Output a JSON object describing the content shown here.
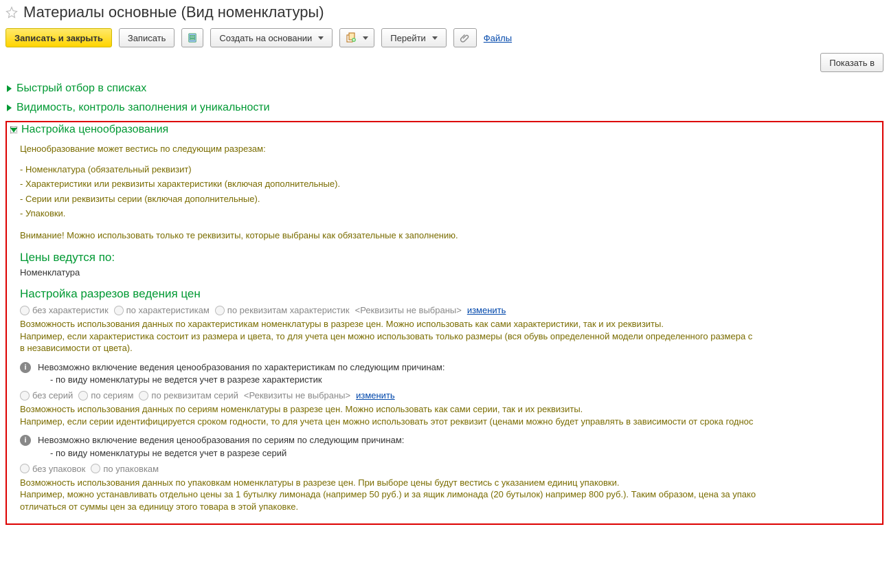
{
  "header": {
    "title": "Материалы основные (Вид номенклатуры)"
  },
  "toolbar": {
    "save_close": "Записать и закрыть",
    "save": "Записать",
    "create_based": "Создать на основании",
    "goto": "Перейти",
    "files_link": "Файлы",
    "show_all": "Показать в"
  },
  "sections": {
    "quick_filter": "Быстрый отбор в списках",
    "visibility": "Видимость, контроль заполнения и уникальности",
    "pricing": {
      "title": "Настройка ценообразования",
      "intro": "Ценообразование может вестись по следующим разрезам:",
      "items": [
        "- Номенклатура (обязательный реквизит)",
        "- Характеристики или реквизиты характеристики (включая дополнительные).",
        "- Серии или реквизиты серии (включая дополнительные).",
        "- Упаковки."
      ],
      "warning": "Внимание! Можно использовать только те реквизиты, которые выбраны как обязательные к заполнению.",
      "prices_by_heading": "Цены ведутся по:",
      "prices_by_value": "Номенклатура",
      "slices_heading": "Настройка разрезов ведения цен",
      "char_radios": {
        "r1": "без характеристик",
        "r2": "по характеристикам",
        "r3": "по реквизитам характеристик",
        "hint": "<Реквизиты не выбраны>",
        "change": "изменить"
      },
      "char_desc": "Возможность использования данных по характеристикам номенклатуры в разрезе цен. Можно использовать как сами характеристики, так и их реквизиты.\nНапример, если характеристика состоит из размера и цвета, то для учета цен можно использовать только размеры (вся обувь определенной модели определенного размера с\nв независимости от цвета).",
      "char_info_line1": "Невозможно включение ведения ценообразования по характеристикам по следующим причинам:",
      "char_info_line2": "- по виду номенклатуры не ведется учет в разрезе характеристик",
      "series_radios": {
        "r1": "без серий",
        "r2": "по сериям",
        "r3": "по реквизитам серий",
        "hint": "<Реквизиты не выбраны>",
        "change": "изменить"
      },
      "series_desc": "Возможность использования данных по сериям номенклатуры в разрезе цен. Можно использовать как сами серии, так и их реквизиты.\nНапример, если серии идентифицируется сроком годности, то для учета цен можно использовать этот реквизит (ценами можно будет управлять в зависимости от срока годнос",
      "series_info_line1": "Невозможно включение ведения ценообразования по сериям по следующим причинам:",
      "series_info_line2": "- по виду номенклатуры не ведется учет в разрезе серий",
      "pack_radios": {
        "r1": "без упаковок",
        "r2": "по упаковкам"
      },
      "pack_desc": "Возможность использования данных по упаковкам номенклатуры в разрезе цен. При выборе цены будут вестись с указанием единиц упаковки.\nНапример, можно устанавливать отдельно цены за 1 бутылку лимонада (например 50 руб.) и за ящик лимонада (20 бутылок) например 800 руб.). Таким образом, цена за упако\nотличаться от суммы цен за единицу этого товара в этой упаковке."
    }
  }
}
